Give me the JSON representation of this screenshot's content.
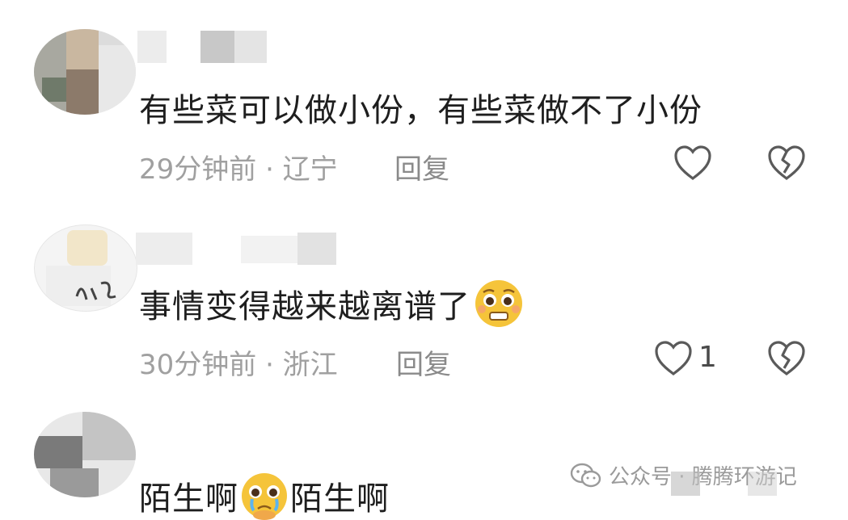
{
  "comments": [
    {
      "text": "有些菜可以做小份，有些菜做不了小份",
      "time_location": "29分钟前 · 辽宁",
      "reply_label": "回复",
      "like_count": ""
    },
    {
      "text": "事情变得越来越离谱了",
      "emoji": "pleading-face-emoji",
      "time_location": "30分钟前 · 浙江",
      "reply_label": "回复",
      "like_count": "1"
    },
    {
      "text_before": "陌生啊",
      "emoji": "crying-pleading-face-emoji",
      "text_after": "陌生啊"
    }
  ],
  "watermark": {
    "icon": "wechat-icon",
    "text": "公众号 · 腾腾环游记"
  },
  "colors": {
    "text": "#1e1e1e",
    "meta": "#a0a0a0",
    "icon": "#5a5a5a",
    "emoji": "#f5c43a"
  }
}
